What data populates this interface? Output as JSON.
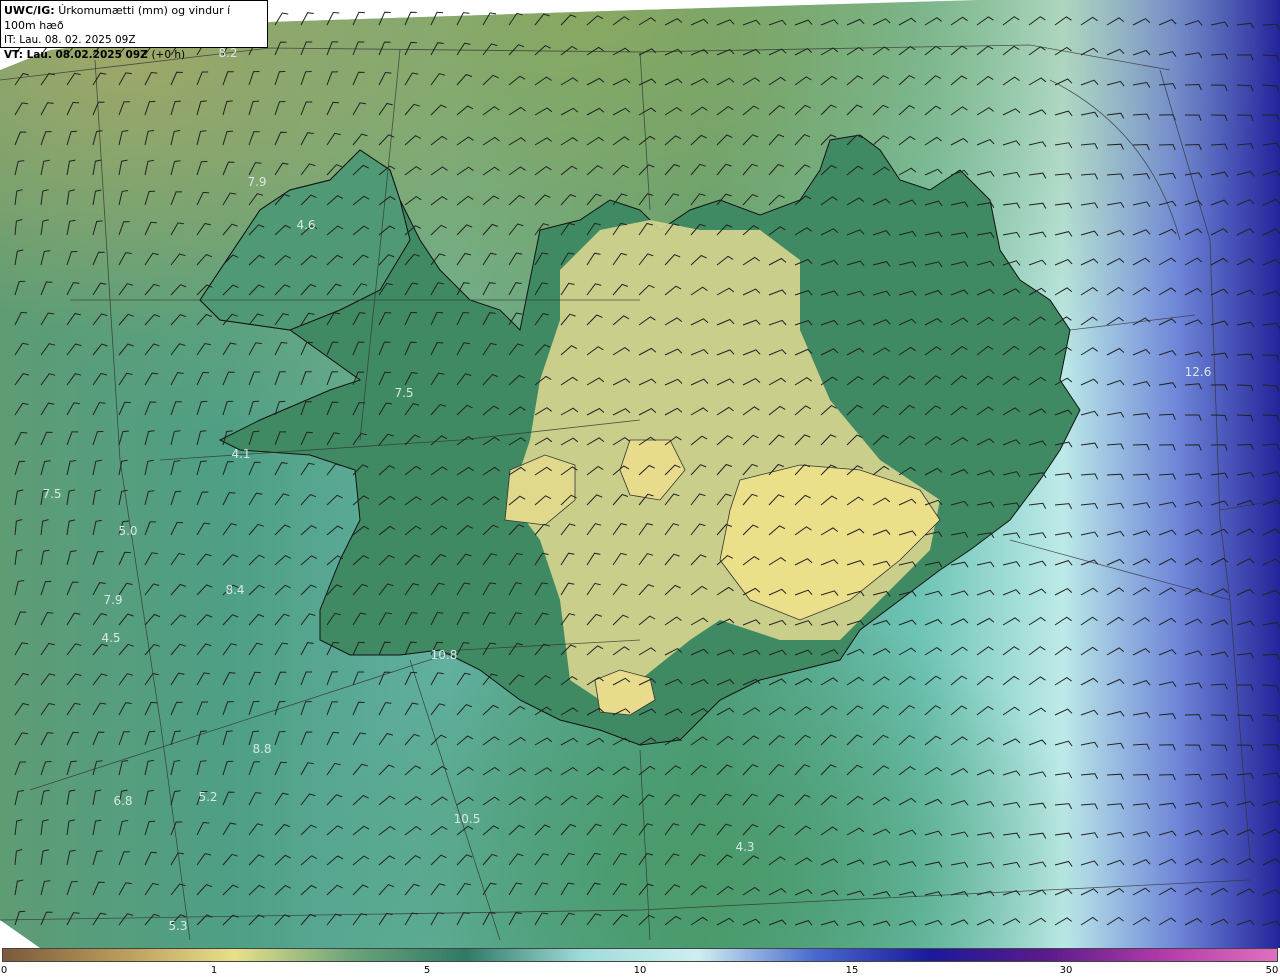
{
  "header": {
    "model": "UWC/IG:",
    "title": "Úrkomumætti (mm) og vindur í 100m hæð",
    "issue_time": "IT: Lau. 08. 02. 2025 09Z",
    "valid_time": "VT: Lau. 08.02.2025 09Z",
    "lead": "(+0 h)"
  },
  "value_labels": [
    {
      "text": "8.2"
    },
    {
      "text": "7.9"
    },
    {
      "text": "4.6"
    },
    {
      "text": "4.1"
    },
    {
      "text": "7.5"
    },
    {
      "text": "5.0"
    },
    {
      "text": "7.9"
    },
    {
      "text": "8.4"
    },
    {
      "text": "4.5"
    },
    {
      "text": "10.8"
    },
    {
      "text": "8.8"
    },
    {
      "text": "6.8"
    },
    {
      "text": "5.2"
    },
    {
      "text": "10.5"
    },
    {
      "text": "4.3"
    },
    {
      "text": "5.3"
    },
    {
      "text": "12.6"
    },
    {
      "text": "7.5"
    }
  ],
  "colorbar": {
    "ticks": [
      "0",
      "1",
      "5",
      "10",
      "15",
      "30",
      "50"
    ],
    "colors": [
      "#7a5a3a",
      "#b89a5a",
      "#e8e08a",
      "#6aa47a",
      "#2f7a66",
      "#9fdcd8",
      "#cfeff0",
      "#4a6ad0",
      "#1a1a9a",
      "#5a1a8a",
      "#b03aa8",
      "#e070c0"
    ]
  },
  "barb_color": "#222222"
}
